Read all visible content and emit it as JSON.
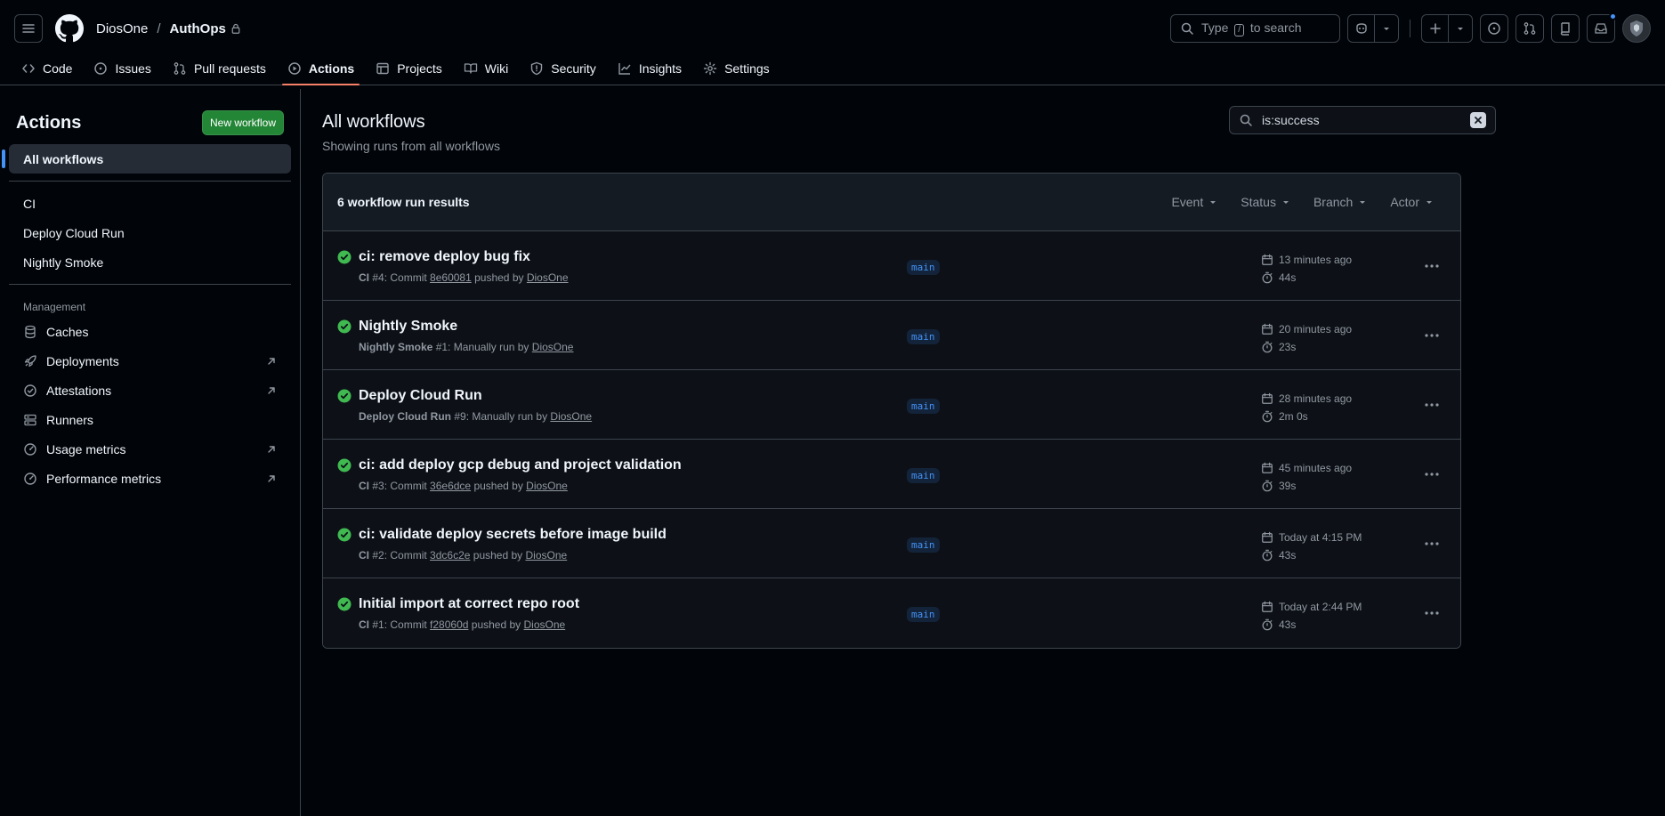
{
  "header": {
    "owner": "DiosOne",
    "separator": "/",
    "repo": "AuthOps",
    "search_prefix": "Type",
    "search_key": "/",
    "search_suffix": "to search"
  },
  "tabs": [
    {
      "label": "Code",
      "icon": "code-icon"
    },
    {
      "label": "Issues",
      "icon": "issue-icon"
    },
    {
      "label": "Pull requests",
      "icon": "pull-request-icon"
    },
    {
      "label": "Actions",
      "icon": "play-icon"
    },
    {
      "label": "Projects",
      "icon": "table-icon"
    },
    {
      "label": "Wiki",
      "icon": "book-icon"
    },
    {
      "label": "Security",
      "icon": "shield-icon"
    },
    {
      "label": "Insights",
      "icon": "graph-icon"
    },
    {
      "label": "Settings",
      "icon": "gear-icon"
    }
  ],
  "sidebar": {
    "title": "Actions",
    "new_workflow": "New workflow",
    "all_workflows": "All workflows",
    "workflows": [
      "CI",
      "Deploy Cloud Run",
      "Nightly Smoke"
    ],
    "management_title": "Management",
    "management": [
      {
        "label": "Caches",
        "icon": "database-icon"
      },
      {
        "label": "Deployments",
        "icon": "rocket-icon"
      },
      {
        "label": "Attestations",
        "icon": "verified-icon"
      },
      {
        "label": "Runners",
        "icon": "server-icon"
      },
      {
        "label": "Usage metrics",
        "icon": "meter-icon"
      },
      {
        "label": "Performance metrics",
        "icon": "meter-icon"
      }
    ]
  },
  "main": {
    "title": "All workflows",
    "subtitle": "Showing runs from all workflows",
    "filter_value": "is:success",
    "results_label": "6 workflow run results",
    "filters": [
      "Event",
      "Status",
      "Branch",
      "Actor"
    ]
  },
  "runs": [
    {
      "title": "ci: remove deploy bug fix",
      "workflow": "CI",
      "detail": "#4: Commit",
      "sha": "8e60081",
      "by": "pushed by",
      "actor": "DiosOne",
      "branch": "main",
      "when": "13 minutes ago",
      "duration": "44s"
    },
    {
      "title": "Nightly Smoke",
      "workflow": "Nightly Smoke",
      "detail": "#1: Manually run by",
      "sha": "",
      "by": "",
      "actor": "DiosOne",
      "branch": "main",
      "when": "20 minutes ago",
      "duration": "23s"
    },
    {
      "title": "Deploy Cloud Run",
      "workflow": "Deploy Cloud Run",
      "detail": "#9: Manually run by",
      "sha": "",
      "by": "",
      "actor": "DiosOne",
      "branch": "main",
      "when": "28 minutes ago",
      "duration": "2m 0s"
    },
    {
      "title": "ci: add deploy gcp debug and project validation",
      "workflow": "CI",
      "detail": "#3: Commit",
      "sha": "36e6dce",
      "by": "pushed by",
      "actor": "DiosOne",
      "branch": "main",
      "when": "45 minutes ago",
      "duration": "39s"
    },
    {
      "title": "ci: validate deploy secrets before image build",
      "workflow": "CI",
      "detail": "#2: Commit",
      "sha": "3dc6c2e",
      "by": "pushed by",
      "actor": "DiosOne",
      "branch": "main",
      "when": "Today at 4:15 PM",
      "duration": "43s"
    },
    {
      "title": "Initial import at correct repo root",
      "workflow": "CI",
      "detail": "#1: Commit",
      "sha": "f28060d",
      "by": "pushed by",
      "actor": "DiosOne",
      "branch": "main",
      "when": "Today at 2:44 PM",
      "duration": "43s"
    }
  ],
  "colors": {
    "accent": "#4493f8",
    "success": "#3fb950",
    "primary_button": "#238636",
    "active_tab": "#f78166"
  }
}
